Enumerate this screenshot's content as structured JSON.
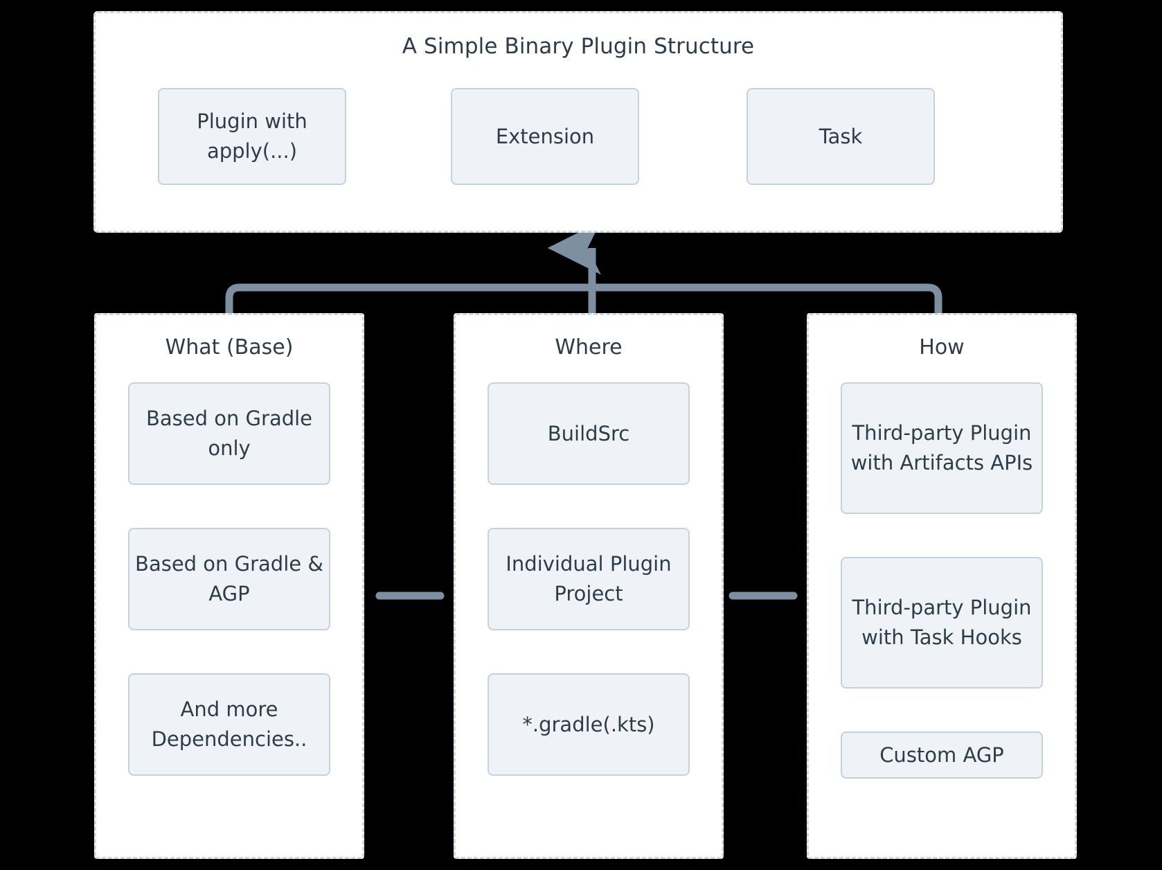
{
  "diagram": {
    "title": "A Simple Binary Plugin Structure",
    "top_nodes": [
      {
        "label": "Plugin with apply(...)"
      },
      {
        "label": "Extension"
      },
      {
        "label": "Task"
      }
    ],
    "columns": [
      {
        "title": "What (Base)",
        "items": [
          {
            "label": "Based on Gradle only"
          },
          {
            "label": "Based on Gradle & AGP"
          },
          {
            "label": "And more Dependencies.."
          }
        ]
      },
      {
        "title": "Where",
        "items": [
          {
            "label": "BuildSrc"
          },
          {
            "label": "Individual Plugin Project"
          },
          {
            "label": "*.gradle(.kts)"
          }
        ]
      },
      {
        "title": "How",
        "items": [
          {
            "label": "Third-party Plugin with Artifacts APIs"
          },
          {
            "label": "Third-party Plugin with Task Hooks"
          },
          {
            "label": "Custom AGP"
          }
        ]
      }
    ]
  },
  "colors": {
    "background": "#000000",
    "surface": "#ffffff",
    "node_fill": "#eff3f7",
    "node_border": "#c3d2de",
    "dashed_border": "#ccd9e4",
    "text": "#2d3c48",
    "connector": "#7e8fa1"
  }
}
